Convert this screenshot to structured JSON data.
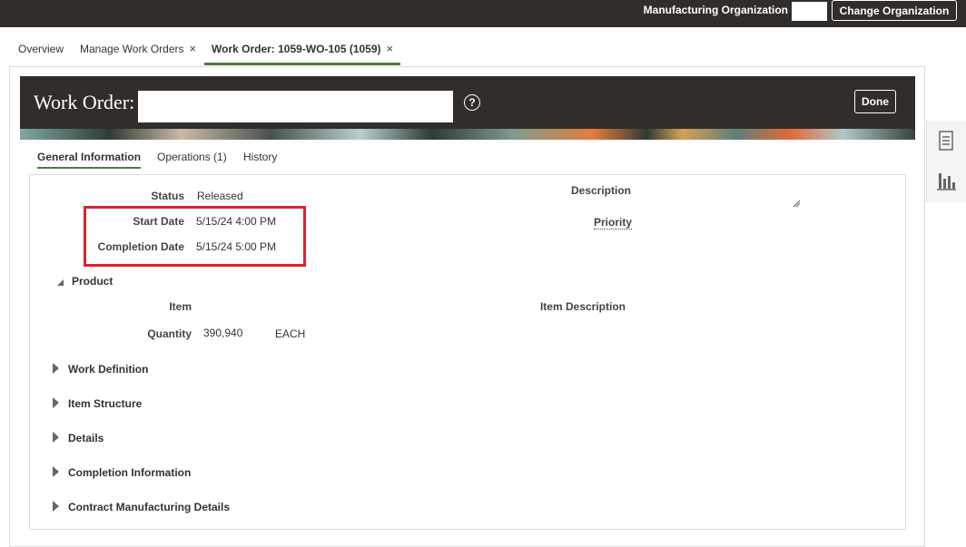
{
  "topbar": {
    "org_label": "Manufacturing Organization",
    "change_org_label": "Change Organization"
  },
  "tabs": [
    {
      "label": "Overview",
      "closable": false
    },
    {
      "label": "Manage Work Orders",
      "closable": true
    },
    {
      "label": "Work Order: 1059-WO-105 (1059)",
      "closable": true,
      "active": true
    }
  ],
  "close_glyph": "×",
  "header": {
    "title": "Work Order:",
    "help_glyph": "?",
    "done_label": "Done"
  },
  "inner_tabs": [
    {
      "label": "General Information",
      "active": true
    },
    {
      "label": "Operations (1)"
    },
    {
      "label": "History"
    }
  ],
  "general": {
    "status_label": "Status",
    "status_value": "Released",
    "start_date_label": "Start Date",
    "start_date_value": "5/15/24 4:00 PM",
    "completion_date_label": "Completion Date",
    "completion_date_value": "5/15/24 5:00 PM",
    "description_label": "Description",
    "priority_label": "Priority"
  },
  "product": {
    "section_label": "Product",
    "item_label": "Item",
    "item_description_label": "Item Description",
    "quantity_label": "Quantity",
    "quantity_value": "390,940",
    "uom_value": "EACH"
  },
  "sections": [
    "Work Definition",
    "Item Structure",
    "Details",
    "Completion Information",
    "Contract Manufacturing Details"
  ],
  "colors": {
    "topbar_bg": "#312d2a",
    "active_tab_underline": "#4e7a42",
    "highlight_box": "#e0202e"
  },
  "icons": {
    "side_panel": [
      "document-list-icon",
      "bar-chart-icon"
    ]
  }
}
